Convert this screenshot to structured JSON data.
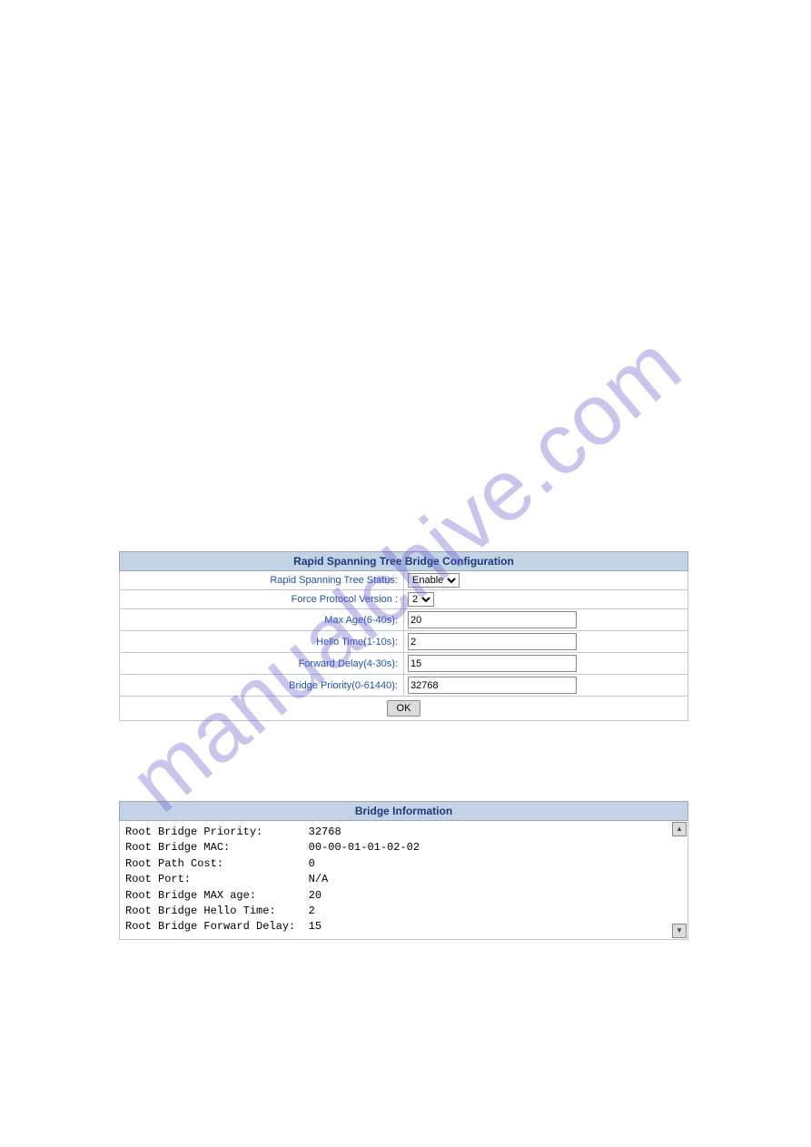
{
  "watermark": "manualchive.com",
  "config": {
    "title": "Rapid Spanning Tree Bridge Configuration",
    "status_label": "Rapid Spanning Tree Status:",
    "status_value": "Enable",
    "version_label": "Force Protocol Version :",
    "version_value": "2",
    "maxage_label": "Max Age(6-40s):",
    "maxage_value": "20",
    "hello_label": "Hello Time(1-10s):",
    "hello_value": "2",
    "forward_label": "Forward Delay(4-30s):",
    "forward_value": "15",
    "priority_label": "Bridge Priority(0-61440):",
    "priority_value": "32768",
    "ok_label": "OK"
  },
  "info": {
    "title": "Bridge Information",
    "rows": [
      {
        "label": "Root Bridge Priority:",
        "value": "32768"
      },
      {
        "label": "Root Bridge MAC:",
        "value": "00-00-01-01-02-02"
      },
      {
        "label": "Root Path Cost:",
        "value": "0"
      },
      {
        "label": "Root Port:",
        "value": "N/A"
      },
      {
        "label": "Root Bridge MAX age:",
        "value": "20"
      },
      {
        "label": "Root Bridge Hello Time:",
        "value": "2"
      },
      {
        "label": "Root Bridge Forward Delay:",
        "value": "15"
      }
    ]
  }
}
